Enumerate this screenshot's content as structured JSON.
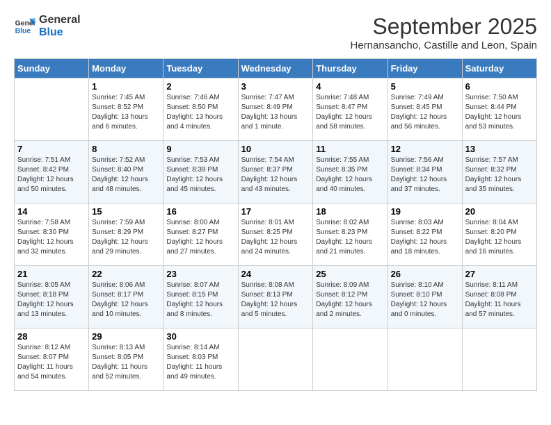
{
  "logo": {
    "line1": "General",
    "line2": "Blue"
  },
  "title": "September 2025",
  "subtitle": "Hernansancho, Castille and Leon, Spain",
  "days_of_week": [
    "Sunday",
    "Monday",
    "Tuesday",
    "Wednesday",
    "Thursday",
    "Friday",
    "Saturday"
  ],
  "weeks": [
    [
      {
        "day": "",
        "info": ""
      },
      {
        "day": "1",
        "info": "Sunrise: 7:45 AM\nSunset: 8:52 PM\nDaylight: 13 hours\nand 6 minutes."
      },
      {
        "day": "2",
        "info": "Sunrise: 7:46 AM\nSunset: 8:50 PM\nDaylight: 13 hours\nand 4 minutes."
      },
      {
        "day": "3",
        "info": "Sunrise: 7:47 AM\nSunset: 8:49 PM\nDaylight: 13 hours\nand 1 minute."
      },
      {
        "day": "4",
        "info": "Sunrise: 7:48 AM\nSunset: 8:47 PM\nDaylight: 12 hours\nand 58 minutes."
      },
      {
        "day": "5",
        "info": "Sunrise: 7:49 AM\nSunset: 8:45 PM\nDaylight: 12 hours\nand 56 minutes."
      },
      {
        "day": "6",
        "info": "Sunrise: 7:50 AM\nSunset: 8:44 PM\nDaylight: 12 hours\nand 53 minutes."
      }
    ],
    [
      {
        "day": "7",
        "info": "Sunrise: 7:51 AM\nSunset: 8:42 PM\nDaylight: 12 hours\nand 50 minutes."
      },
      {
        "day": "8",
        "info": "Sunrise: 7:52 AM\nSunset: 8:40 PM\nDaylight: 12 hours\nand 48 minutes."
      },
      {
        "day": "9",
        "info": "Sunrise: 7:53 AM\nSunset: 8:39 PM\nDaylight: 12 hours\nand 45 minutes."
      },
      {
        "day": "10",
        "info": "Sunrise: 7:54 AM\nSunset: 8:37 PM\nDaylight: 12 hours\nand 43 minutes."
      },
      {
        "day": "11",
        "info": "Sunrise: 7:55 AM\nSunset: 8:35 PM\nDaylight: 12 hours\nand 40 minutes."
      },
      {
        "day": "12",
        "info": "Sunrise: 7:56 AM\nSunset: 8:34 PM\nDaylight: 12 hours\nand 37 minutes."
      },
      {
        "day": "13",
        "info": "Sunrise: 7:57 AM\nSunset: 8:32 PM\nDaylight: 12 hours\nand 35 minutes."
      }
    ],
    [
      {
        "day": "14",
        "info": "Sunrise: 7:58 AM\nSunset: 8:30 PM\nDaylight: 12 hours\nand 32 minutes."
      },
      {
        "day": "15",
        "info": "Sunrise: 7:59 AM\nSunset: 8:29 PM\nDaylight: 12 hours\nand 29 minutes."
      },
      {
        "day": "16",
        "info": "Sunrise: 8:00 AM\nSunset: 8:27 PM\nDaylight: 12 hours\nand 27 minutes."
      },
      {
        "day": "17",
        "info": "Sunrise: 8:01 AM\nSunset: 8:25 PM\nDaylight: 12 hours\nand 24 minutes."
      },
      {
        "day": "18",
        "info": "Sunrise: 8:02 AM\nSunset: 8:23 PM\nDaylight: 12 hours\nand 21 minutes."
      },
      {
        "day": "19",
        "info": "Sunrise: 8:03 AM\nSunset: 8:22 PM\nDaylight: 12 hours\nand 18 minutes."
      },
      {
        "day": "20",
        "info": "Sunrise: 8:04 AM\nSunset: 8:20 PM\nDaylight: 12 hours\nand 16 minutes."
      }
    ],
    [
      {
        "day": "21",
        "info": "Sunrise: 8:05 AM\nSunset: 8:18 PM\nDaylight: 12 hours\nand 13 minutes."
      },
      {
        "day": "22",
        "info": "Sunrise: 8:06 AM\nSunset: 8:17 PM\nDaylight: 12 hours\nand 10 minutes."
      },
      {
        "day": "23",
        "info": "Sunrise: 8:07 AM\nSunset: 8:15 PM\nDaylight: 12 hours\nand 8 minutes."
      },
      {
        "day": "24",
        "info": "Sunrise: 8:08 AM\nSunset: 8:13 PM\nDaylight: 12 hours\nand 5 minutes."
      },
      {
        "day": "25",
        "info": "Sunrise: 8:09 AM\nSunset: 8:12 PM\nDaylight: 12 hours\nand 2 minutes."
      },
      {
        "day": "26",
        "info": "Sunrise: 8:10 AM\nSunset: 8:10 PM\nDaylight: 12 hours\nand 0 minutes."
      },
      {
        "day": "27",
        "info": "Sunrise: 8:11 AM\nSunset: 8:08 PM\nDaylight: 11 hours\nand 57 minutes."
      }
    ],
    [
      {
        "day": "28",
        "info": "Sunrise: 8:12 AM\nSunset: 8:07 PM\nDaylight: 11 hours\nand 54 minutes."
      },
      {
        "day": "29",
        "info": "Sunrise: 8:13 AM\nSunset: 8:05 PM\nDaylight: 11 hours\nand 52 minutes."
      },
      {
        "day": "30",
        "info": "Sunrise: 8:14 AM\nSunset: 8:03 PM\nDaylight: 11 hours\nand 49 minutes."
      },
      {
        "day": "",
        "info": ""
      },
      {
        "day": "",
        "info": ""
      },
      {
        "day": "",
        "info": ""
      },
      {
        "day": "",
        "info": ""
      }
    ]
  ]
}
